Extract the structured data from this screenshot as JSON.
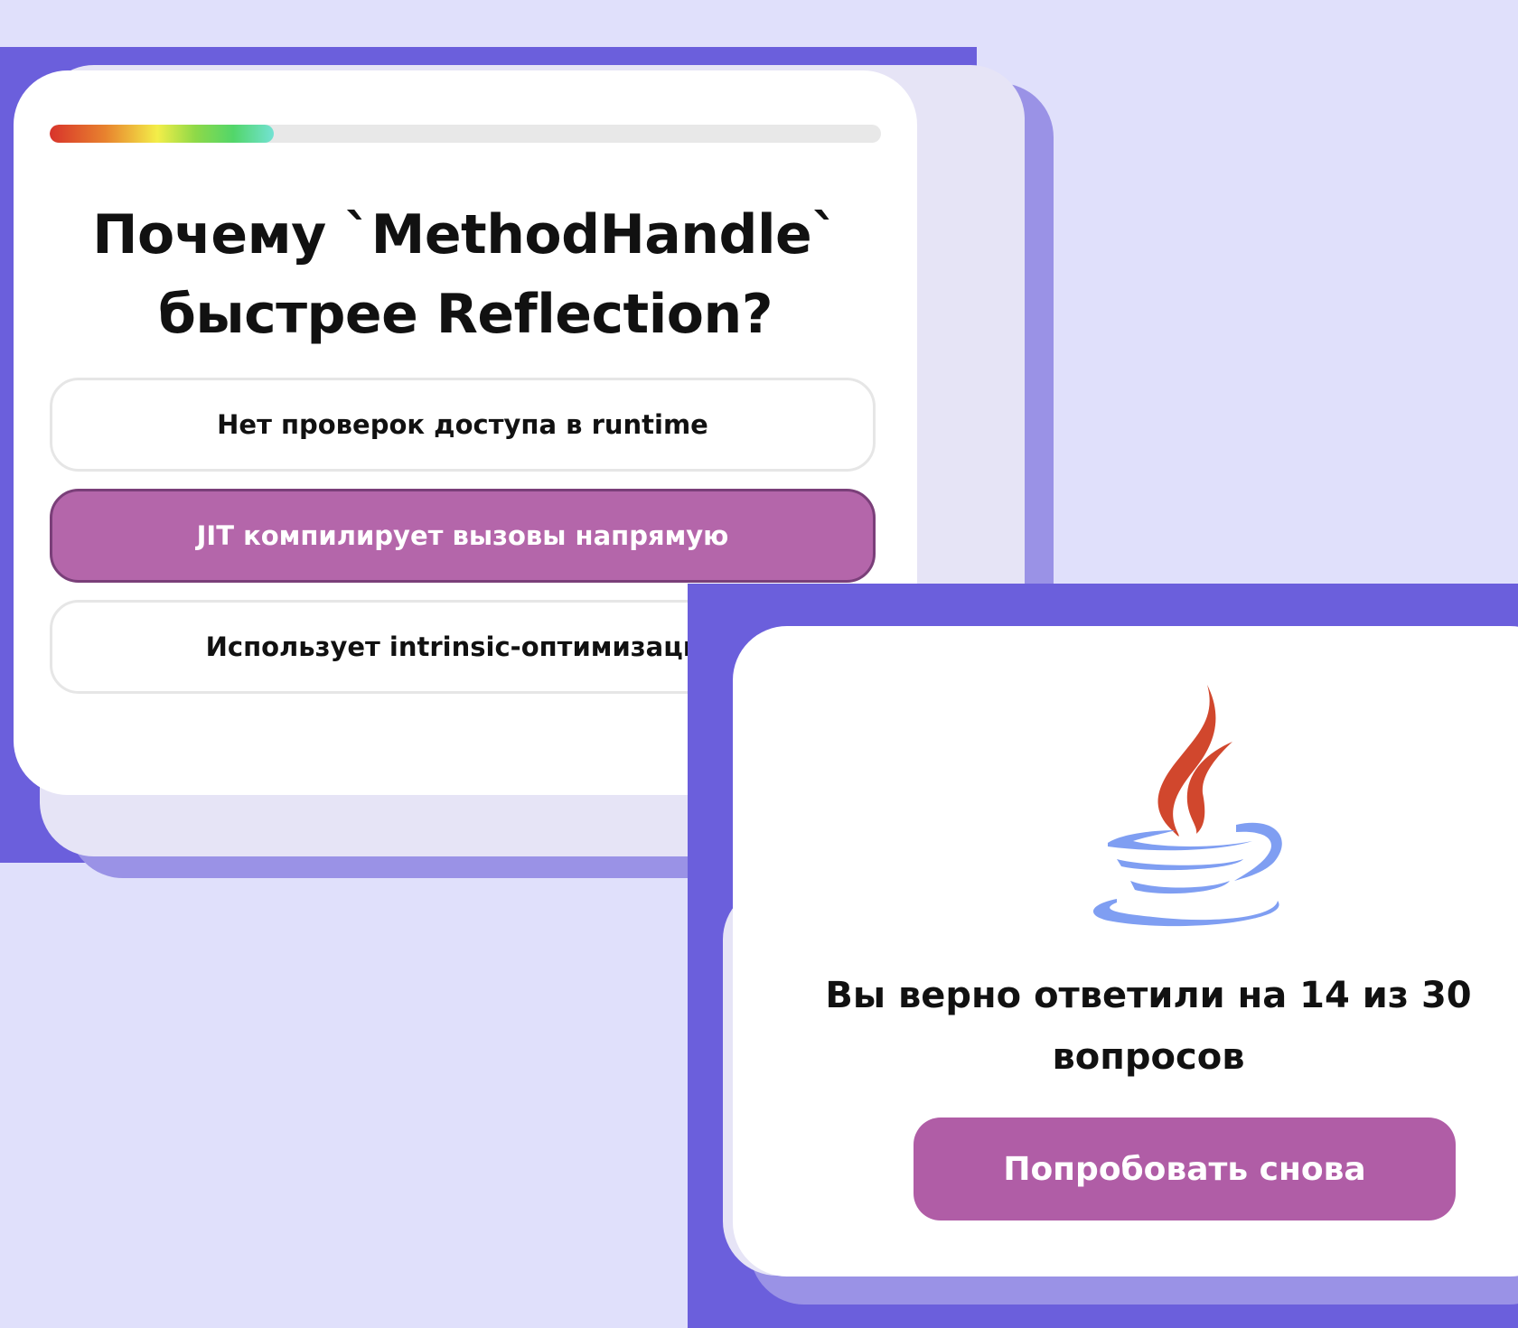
{
  "quiz": {
    "progress_fraction": 0.27,
    "question": "Почему `MethodHandle` быстрее Reflection?",
    "answers": [
      {
        "label": "Нет проверок доступа в runtime",
        "selected": false
      },
      {
        "label": "JIT компилирует вызовы напрямую",
        "selected": true
      },
      {
        "label": "Использует intrinsic-оптимизации",
        "selected": false
      }
    ]
  },
  "result": {
    "logo": "java-coffee-cup-logo",
    "message": "Вы верно ответили на 14 из 30 вопросов",
    "retry_label": "Попробовать снова"
  },
  "colors": {
    "page_background": "#e0e0fb",
    "panel_background": "#6b5fdc",
    "accent_button": "#b05da6",
    "selected_answer": "#b466aa",
    "java_flame": "#d1472d",
    "java_cup": "#7f9ef2"
  }
}
